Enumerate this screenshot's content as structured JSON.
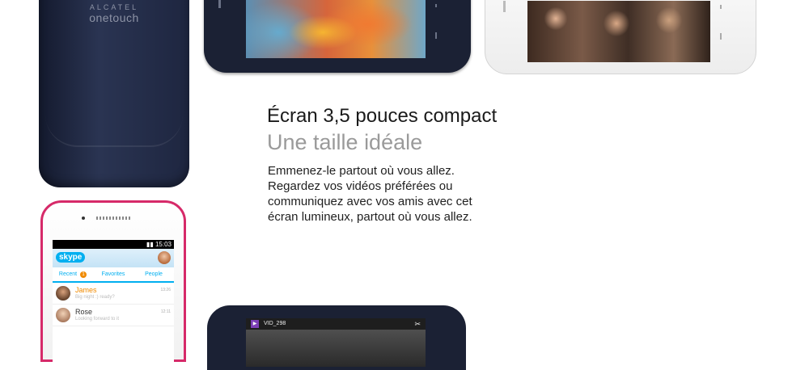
{
  "hero": {
    "title": "Écran 3,5 pouces compact",
    "subtitle": "Une taille idéale",
    "body_lines": [
      "Emmenez-le partout où vous allez.",
      "Regardez vos vidéos préférées ou",
      "communiquez avec vos amis avec cet",
      "écran lumineux, partout où vous allez."
    ]
  },
  "brand": {
    "top": "ALCATEL",
    "bottom": "onetouch"
  },
  "skype_screen": {
    "status_time": "15:03",
    "logo": "skype",
    "tabs": [
      {
        "label": "Recent",
        "count": "1"
      },
      {
        "label": "Favorites"
      },
      {
        "label": "People"
      }
    ],
    "contacts": [
      {
        "name": "James",
        "message": "Big night :) ready?",
        "time": "13:26",
        "name_color": "#f08a00"
      },
      {
        "name": "Rose",
        "message": "Looking forward to it",
        "time": "12:11",
        "name_color": "#333333"
      }
    ]
  },
  "video_screen": {
    "filename": "VID_298"
  },
  "colors": {
    "navy": "#1b2134",
    "pink_frame": "#d62a69",
    "skype_blue": "#00aff0",
    "badge_orange": "#f08a00",
    "heading": "#1a1a1a",
    "subheading": "#9a9a9a"
  }
}
